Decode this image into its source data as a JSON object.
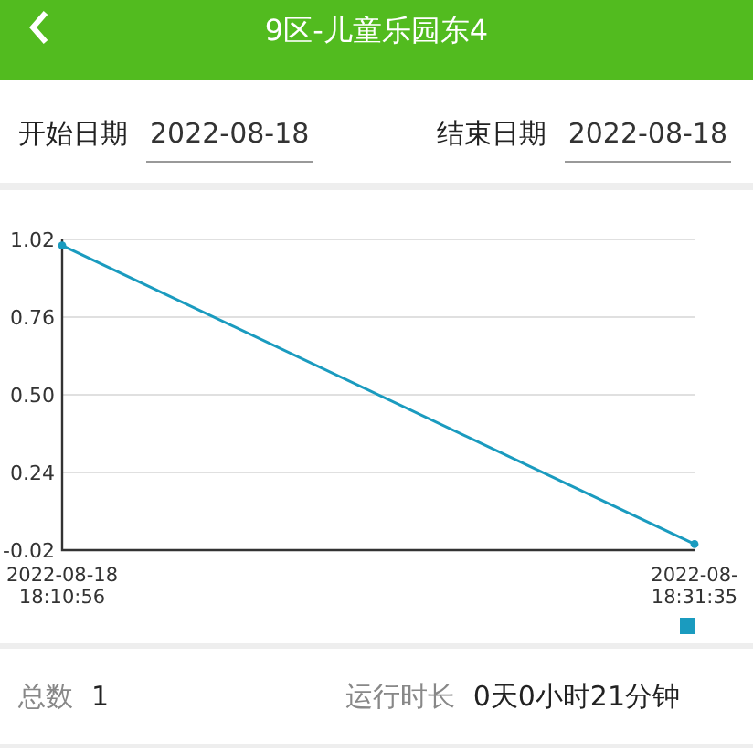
{
  "header": {
    "title": "9区-儿童乐园东4"
  },
  "dates": [
    {
      "label": "开始日期",
      "value": "2022-08-18"
    },
    {
      "label": "结束日期",
      "value": "2022-08-18"
    }
  ],
  "chart": {
    "chart_data": {
      "type": "line",
      "categories": [
        "2022-08-18 18:10:56",
        "2022-08- 18:31:35"
      ],
      "ylim": [
        -0.02,
        1.02
      ],
      "yticks": [
        {
          "value": -0.02,
          "label": "-0.02"
        },
        {
          "value": 0.24,
          "label": "0.24"
        },
        {
          "value": 0.5,
          "label": "0.50"
        },
        {
          "value": 0.76,
          "label": "0.76"
        },
        {
          "value": 1.02,
          "label": "1.02"
        }
      ],
      "series": [
        {
          "color": "#1a9bbf",
          "marker": "circle",
          "values": [
            1.0,
            0.0
          ]
        }
      ]
    }
  },
  "stats": [
    {
      "label": "总数",
      "value": "1"
    },
    {
      "label": "运行时长",
      "value": "0天0小时21分钟"
    }
  ]
}
